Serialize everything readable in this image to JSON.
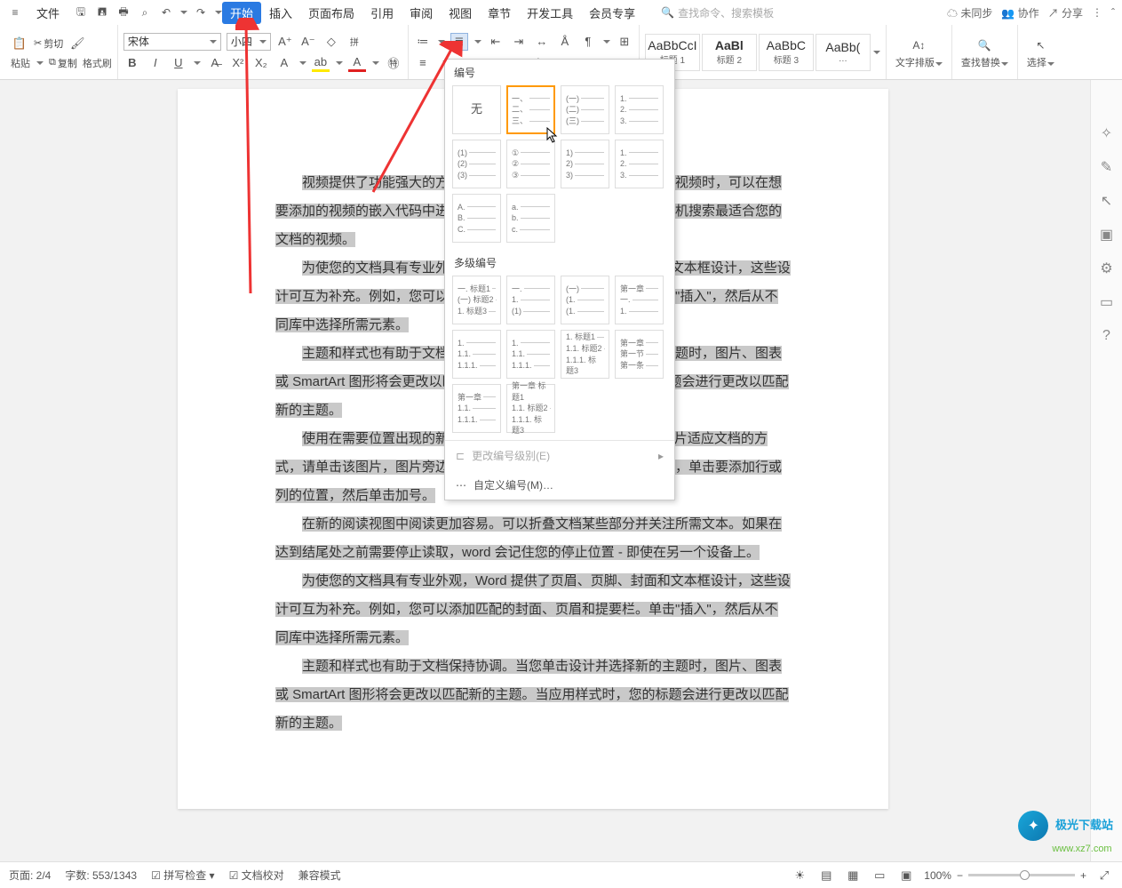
{
  "topbar": {
    "file_menu": "文件",
    "search_placeholder": "查找命令、搜索模板",
    "unsync": "未同步",
    "collab": "协作",
    "share": "分享"
  },
  "tabs": {
    "start": "开始",
    "insert": "插入",
    "layout": "页面布局",
    "reference": "引用",
    "review": "审阅",
    "view": "视图",
    "chapter": "章节",
    "devtools": "开发工具",
    "vip": "会员专享"
  },
  "ribbon": {
    "paste": "粘贴",
    "cut": "剪切",
    "copy": "复制",
    "fmt_painter": "格式刷",
    "font_name": "宋体",
    "font_size": "小四",
    "style1": "AaBbCcI",
    "style2": "AaBl",
    "style3": "AaBbC",
    "style4": "AaBb(",
    "style1_lbl": "标题 1",
    "style2_lbl": "标题 2",
    "style3_lbl": "标题 3",
    "text_dir": "文字排版",
    "find": "查找替换",
    "select": "选择"
  },
  "numbering_panel": {
    "header1": "编号",
    "none": "无",
    "header2": "多级编号",
    "change_level": "更改编号级别(E)",
    "custom": "自定义编号(M)…",
    "simple": [
      [
        "一、",
        "二、",
        "三、"
      ],
      [
        "(一)",
        "(二)",
        "(三)"
      ],
      [
        "1.",
        "2.",
        "3."
      ],
      [
        "(1)",
        "(2)",
        "(3)"
      ],
      [
        "①",
        "②",
        "③"
      ],
      [
        "1)",
        "2)",
        "3)"
      ],
      [
        "1.",
        "2.",
        "3."
      ],
      [
        "A.",
        "B.",
        "C."
      ],
      [
        "a.",
        "b.",
        "c."
      ]
    ],
    "multilevel": [
      [
        "一. 标题1",
        "(一) 标题2",
        "1. 标题3"
      ],
      [
        "一.",
        "1.",
        "(1)"
      ],
      [
        "(一)",
        "(1.",
        "(1."
      ],
      [
        "第一章",
        "一.",
        "1."
      ],
      [
        "1.",
        "1.1.",
        "1.1.1."
      ],
      [
        "1.",
        "1.1.",
        "1.1.1."
      ],
      [
        "1. 标题1",
        "1.1. 标题2",
        "1.1.1. 标题3"
      ],
      [
        "第一章",
        "第一节",
        "第一条"
      ],
      [
        "第一章",
        "1.1.",
        "1.1.1."
      ],
      [
        "第一章 标题1",
        "1.1. 标题2",
        "1.1.1. 标题3"
      ]
    ]
  },
  "document": {
    "p1": "视频提供了功能强大的方法帮助您证明您的观点。当您单击联机视频时，可以在想要添加的视频的嵌入代码中进行粘贴。您也可以键入一个关键字以联机搜索最适合您的文档的视频。",
    "p2": "为使您的文档具有专业外观，Word 提供了页眉、页脚、封面和文本框设计，这些设计可互为补充。例如，您可以添加匹配的封面、页眉和提要栏。单击\"插入\"，然后从不同库中选择所需元素。",
    "p3": "主题和样式也有助于文档保持协调。当您单击设计并选择新的主题时，图片、图表或 SmartArt 图形将会更改以匹配新的主题。当应用样式时，您的标题会进行更改以匹配新的主题。",
    "p4a": "使用在需要位置出现的新按钮在 Word 中保存时间。若要更改图片适应文档的方式，请单击该图片，图片旁边将会显示布局选项按钮。当处理表格时，单击要添加行或列的位置，然后单击加号。",
    "p5": "在新的阅读视图中阅读更加容易。可以折叠文档某些部分并关注所需文本。如果在达到结尾处之前需要停止读取，word 会记住您的停止位置 - 即使在另一个设备上。",
    "p6": "为使您的文档具有专业外观，Word 提供了页眉、页脚、封面和文本框设计，这些设计可互为补充。例如，您可以添加匹配的封面、页眉和提要栏。单击\"插入\"，然后从不同库中选择所需元素。",
    "p7": "主题和样式也有助于文档保持协调。当您单击设计并选择新的主题时，图片、图表或 SmartArt 图形将会更改以匹配新的主题。当应用样式时，您的标题会进行更改以匹配新的主题。"
  },
  "status": {
    "page": "页面: 2/4",
    "words": "字数: 553/1343",
    "spell": "拼写检查",
    "proof": "文档校对",
    "compat": "兼容模式",
    "zoom": "100%"
  },
  "watermark": {
    "title": "极光下载站",
    "url": "www.xz7.com"
  }
}
